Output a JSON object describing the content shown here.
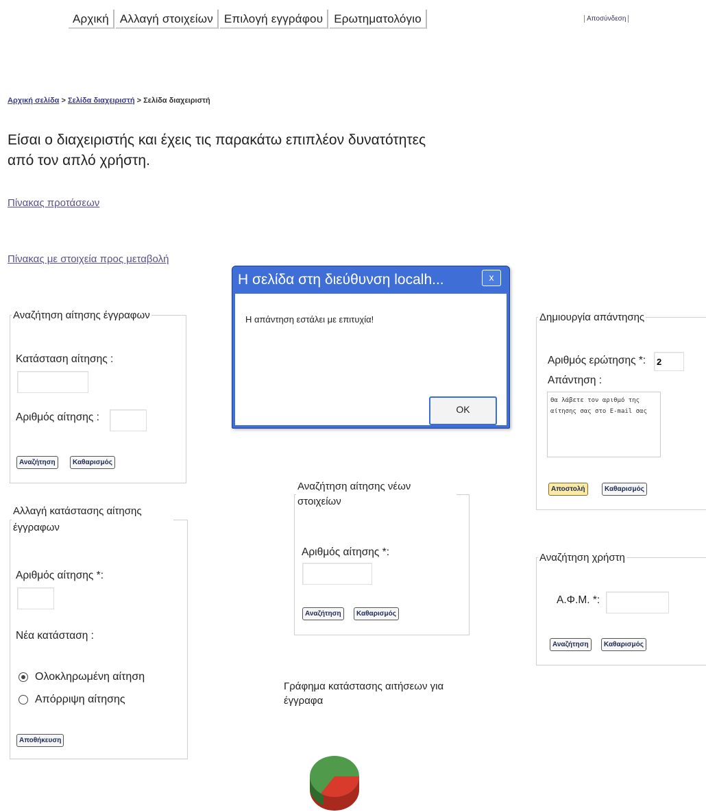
{
  "nav": {
    "items": [
      "Αρχική",
      "Αλλαγή στοιχείων",
      "Επιλογή εγγράφου",
      "Ερωτηματολόγιο"
    ],
    "logout": "Αποσύνδεση"
  },
  "breadcrumb": {
    "home": "Αρχική σελίδα",
    "sep": ">",
    "admin": "Σελίδα διαχειριστή",
    "current": "Σελίδα διαχειριστή"
  },
  "intro": "Είσαι ο διαχειριστής και έχεις τις παρακάτω επιπλέον δυνατότητες από τον απλό χρήστη.",
  "links": {
    "proposals": "Πίνακας προτάσεων",
    "changes": "Πίνακας με στοιχεία προς μεταβολή"
  },
  "search_doc": {
    "legend": "Αναζήτηση αίτησης έγγραφων",
    "status_label": "Κατάσταση αίτησης :",
    "status_value": "",
    "number_label": "Αριθμός αίτησης :",
    "number_value": "",
    "search_btn": "Αναζήτηση",
    "clear_btn": "Καθαρισμός"
  },
  "change_status": {
    "legend": "Αλλαγή κατάστασης αίτησης έγγραφων",
    "number_label": "Αριθμός αίτησης *:",
    "number_value": "",
    "new_status_label": "Νέα κατάσταση :",
    "option_complete": "Ολοκληρωμένη αίτηση",
    "option_reject": "Απόρριψη αίτησης",
    "selected": "Ολοκληρωμένη αίτηση",
    "save_btn": "Αποθήκευση"
  },
  "search_new": {
    "legend": "Αναζήτηση αίτησης νέων στοιχείων",
    "number_label": "Αριθμός αίτησης *:",
    "number_value": "",
    "search_btn": "Αναζήτηση",
    "clear_btn": "Καθαρισμός"
  },
  "chart": {
    "title": "Γράφημα κατάστασης αιτήσεων για έγγραφα"
  },
  "chart_data": {
    "type": "pie",
    "colors": [
      "#d83a2c",
      "#4f9a4b"
    ]
  },
  "answer": {
    "legend": "Δημιουργία απάντησης",
    "question_label": "Αριθμός ερώτησης *:",
    "question_value": "2",
    "answer_label": "Απάντηση :",
    "answer_text": "Θα λάβετε τον αριθμό της αίτησης σας στο E-mail σας",
    "send_btn": "Αποστολή",
    "clear_btn": "Καθαρισμός"
  },
  "search_user": {
    "legend": "Αναζήτηση χρήστη",
    "afm_label": "Α.Φ.Μ. *:",
    "afm_value": "",
    "search_btn": "Αναζήτηση",
    "clear_btn": "Καθαρισμός"
  },
  "dialog": {
    "title": "Η σελίδα στη διεύθυνση localh...",
    "close": "x",
    "message": "Η απάντηση εστάλει με επιτυχία!",
    "ok": "OK"
  }
}
